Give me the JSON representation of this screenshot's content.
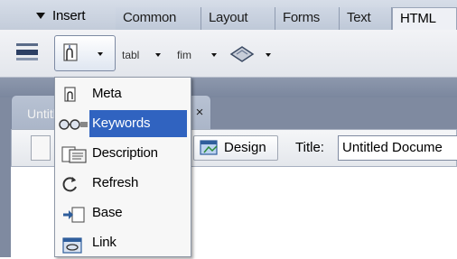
{
  "insert_bar": {
    "label": "Insert",
    "tabs": [
      {
        "label": "Common",
        "active": false
      },
      {
        "label": "Layout",
        "active": false
      },
      {
        "label": "Forms",
        "active": false
      },
      {
        "label": "Text",
        "active": false
      },
      {
        "label": "HTML",
        "active": true
      }
    ]
  },
  "toolbar": {
    "items": [
      {
        "icon": "horizontal-rule-icon"
      },
      {
        "icon": "head-icon",
        "has_dropdown": true
      },
      {
        "label": "tabl",
        "has_dropdown": true
      },
      {
        "label": "fim",
        "has_dropdown": true
      },
      {
        "icon": "script-icon",
        "has_dropdown": true
      }
    ]
  },
  "document": {
    "tab_label": "Untitl",
    "design_label": "Design",
    "title_label": "Title:",
    "title_value": "Untitled Docume"
  },
  "head_menu": {
    "items": [
      {
        "label": "Meta",
        "icon": "meta-icon",
        "highlighted": false
      },
      {
        "label": "Keywords",
        "icon": "keywords-icon",
        "highlighted": true
      },
      {
        "label": "Description",
        "icon": "description-icon",
        "highlighted": false
      },
      {
        "label": "Refresh",
        "icon": "refresh-icon",
        "highlighted": false
      },
      {
        "label": "Base",
        "icon": "base-icon",
        "highlighted": false
      },
      {
        "label": "Link",
        "icon": "link-icon",
        "highlighted": false
      }
    ]
  },
  "colors": {
    "highlight": "#3063c0",
    "bar": "#c3ccda",
    "frame": "#7f8aa0"
  }
}
